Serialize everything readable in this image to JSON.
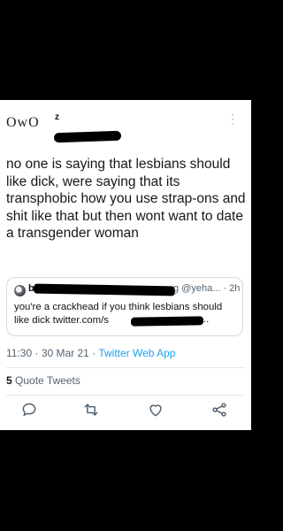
{
  "tweet": {
    "display_name": "OwO",
    "display_sup": "z",
    "text": "no one is saying that lesbians should like dick, were saying that its transphobic how you use strap-ons and shit like that but then wont want to date a transgender woman",
    "time": "11:30",
    "separator": "·",
    "date": "30 Mar 21",
    "source": "Twitter Web App",
    "quote_tweets_count": "5",
    "quote_tweets_label": "Quote Tweets"
  },
  "quoted": {
    "initial": "b",
    "handle_meta": "g @yeha... · 2h",
    "text": "you're a crackhead if you think lesbians should like dick twitter.com/s",
    "ellipsis": ".."
  },
  "colors": {
    "accent": "#1da1f2",
    "secondary_text": "#536471",
    "border": "#cfd9de"
  },
  "icons": {
    "more": "more-vertical-icon",
    "reply": "reply-icon",
    "retweet": "retweet-icon",
    "like": "heart-icon",
    "share": "share-icon"
  }
}
